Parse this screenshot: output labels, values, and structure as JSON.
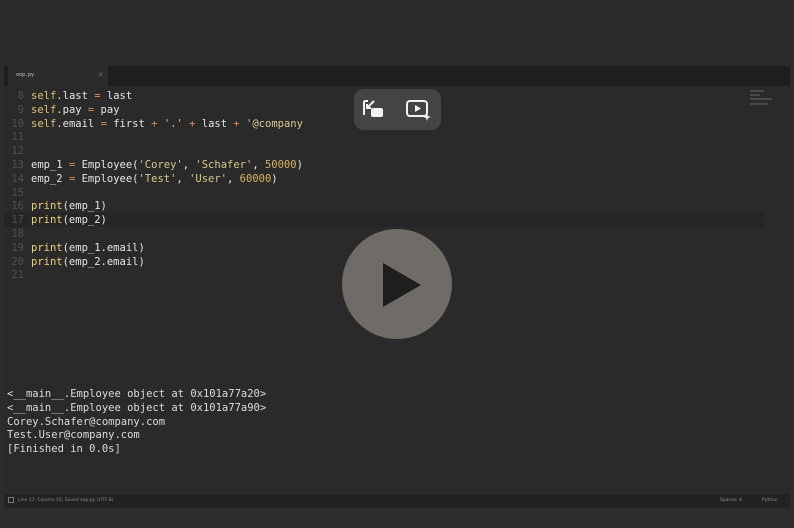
{
  "tab": {
    "filename": "oop.py",
    "close": "×"
  },
  "code_lines": [
    {
      "num": "8",
      "parts": [
        [
          "kw",
          "self"
        ],
        [
          "t",
          ".last "
        ],
        [
          "op",
          "="
        ],
        [
          "t",
          " last"
        ]
      ]
    },
    {
      "num": "9",
      "parts": [
        [
          "kw",
          "self"
        ],
        [
          "t",
          ".pay "
        ],
        [
          "op",
          "="
        ],
        [
          "t",
          " pay"
        ]
      ]
    },
    {
      "num": "10",
      "parts": [
        [
          "kw",
          "self"
        ],
        [
          "t",
          ".email "
        ],
        [
          "op",
          "="
        ],
        [
          "t",
          " first "
        ],
        [
          "op",
          "+"
        ],
        [
          "t",
          " "
        ],
        [
          "str",
          "'.'"
        ],
        [
          "t",
          " "
        ],
        [
          "op",
          "+"
        ],
        [
          "t",
          " last "
        ],
        [
          "op",
          "+"
        ],
        [
          "t",
          " "
        ],
        [
          "str",
          "'@company"
        ]
      ]
    },
    {
      "num": "11",
      "parts": []
    },
    {
      "num": "12",
      "parts": []
    },
    {
      "num": "13",
      "parts": [
        [
          "t",
          "emp_1 "
        ],
        [
          "op",
          "="
        ],
        [
          "t",
          " Employee("
        ],
        [
          "str",
          "'Corey'"
        ],
        [
          "t",
          ", "
        ],
        [
          "str",
          "'Schafer'"
        ],
        [
          "t",
          ", "
        ],
        [
          "num",
          "50000"
        ],
        [
          "t",
          ")"
        ]
      ]
    },
    {
      "num": "14",
      "parts": [
        [
          "t",
          "emp_2 "
        ],
        [
          "op",
          "="
        ],
        [
          "t",
          " Employee("
        ],
        [
          "str",
          "'Test'"
        ],
        [
          "t",
          ", "
        ],
        [
          "str",
          "'User'"
        ],
        [
          "t",
          ", "
        ],
        [
          "num",
          "60000"
        ],
        [
          "t",
          ")"
        ]
      ]
    },
    {
      "num": "15",
      "parts": []
    },
    {
      "num": "16",
      "parts": [
        [
          "fn",
          "print"
        ],
        [
          "t",
          "(emp_1)"
        ]
      ]
    },
    {
      "num": "17",
      "parts": [
        [
          "fn",
          "print"
        ],
        [
          "t",
          "(emp_2)"
        ]
      ],
      "active": true
    },
    {
      "num": "18",
      "parts": []
    },
    {
      "num": "19",
      "parts": [
        [
          "fn",
          "print"
        ],
        [
          "t",
          "(emp_1.email)"
        ]
      ]
    },
    {
      "num": "20",
      "parts": [
        [
          "fn",
          "print"
        ],
        [
          "t",
          "(emp_2.email)"
        ]
      ]
    },
    {
      "num": "21",
      "parts": []
    }
  ],
  "console_output": [
    "<__main__.Employee object at 0x101a77a20>",
    "<__main__.Employee object at 0x101a77a90>",
    "Corey.Schafer@company.com",
    "Test.User@company.com",
    "[Finished in 0.0s]"
  ],
  "status": {
    "position": "Line 17, Column 15; Saved oop.py (UTF-8)",
    "spaces": "Spaces: 4",
    "syntax": "Python"
  },
  "icons": {
    "pip": "exit-pip-icon",
    "enhance": "video-enhance-icon",
    "play": "play-icon"
  },
  "colors": {
    "keyword": "#e0c36c",
    "string": "#d6c98a",
    "number": "#d8b65d",
    "operator": "#e08b5b"
  }
}
